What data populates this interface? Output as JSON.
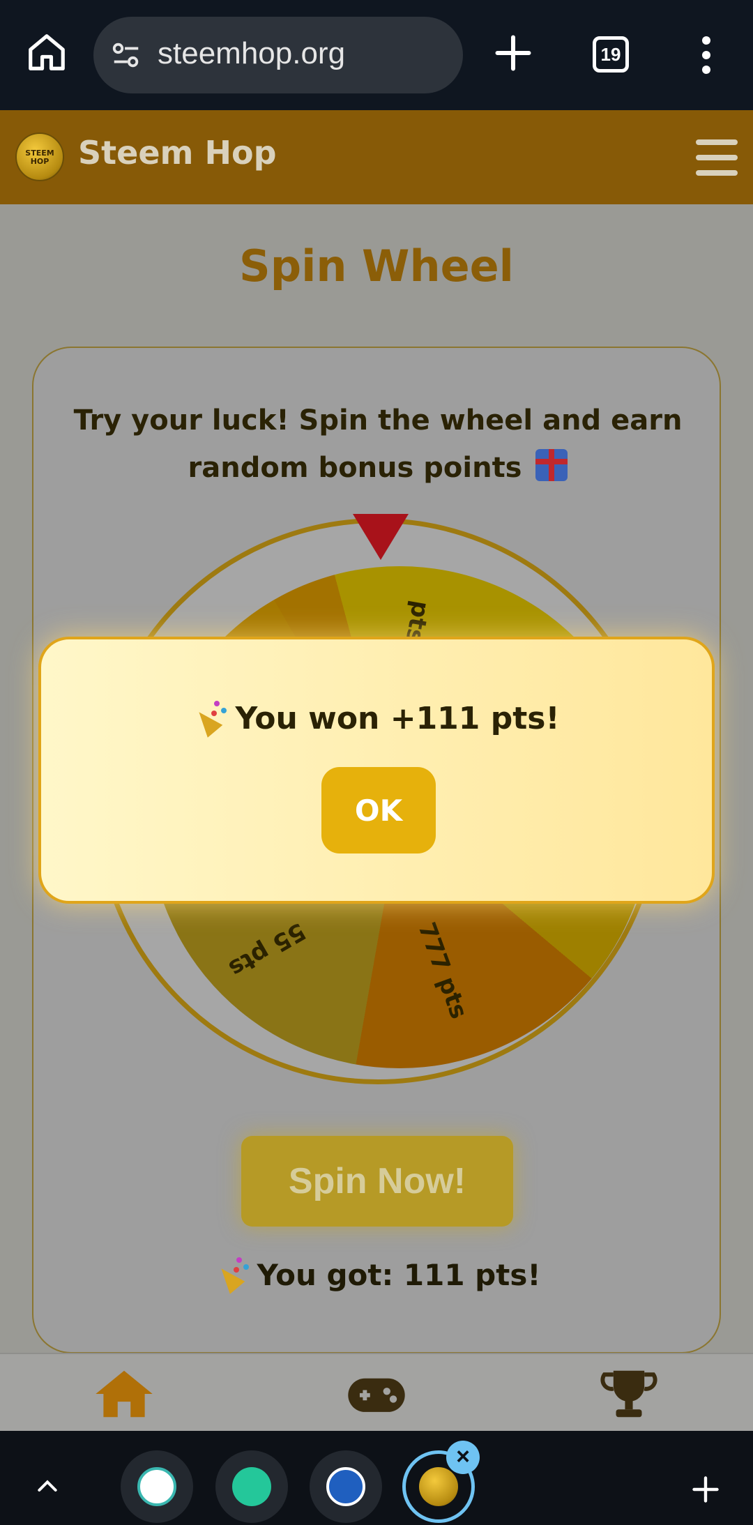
{
  "browser": {
    "url": "steemhop.org",
    "tab_count": "19"
  },
  "site": {
    "title": "Steem Hop",
    "logo_text_top": "STEEM",
    "logo_text_bottom": "HOP"
  },
  "page": {
    "title": "Spin Wheel",
    "intro": "Try your luck! Spin the wheel and earn random bonus points",
    "wheel_labels": {
      "top": "pts",
      "lower_left": "55 pts",
      "lower_right": "777 pts"
    },
    "spin_button": "Spin Now!",
    "result": "You got: 111 pts!"
  },
  "modal": {
    "message": "You won +111 pts!",
    "ok_label": "OK"
  },
  "bottom_nav": {
    "items": [
      {
        "icon": "home-icon",
        "active": true
      },
      {
        "icon": "gamepad-icon",
        "active": false
      },
      {
        "icon": "trophy-icon",
        "active": false
      }
    ]
  },
  "colors": {
    "header": "#875a07",
    "accent": "#e6b10c",
    "title": "#8b5e08"
  }
}
